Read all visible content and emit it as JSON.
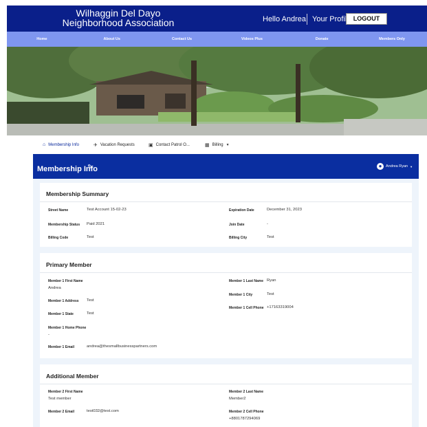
{
  "header": {
    "title_line1": "Wilhaggin Del Dayo",
    "title_line2": "Neighborhood Association",
    "greeting": "Hello Andrea",
    "profile_link": "Your Profile",
    "logout_label": "LOGOUT"
  },
  "nav": [
    "Home",
    "About Us",
    "Contact Us",
    "Videos Plus",
    "Donate",
    "Members Only"
  ],
  "tabs": {
    "membership": "Membership Info",
    "vacation": "Vacation Requests",
    "patrol": "Contact Patrol O...",
    "billing": "Billing"
  },
  "page": {
    "title": "Membership Info",
    "user_name": "Andrea Ryan"
  },
  "summary": {
    "heading": "Membership Summary",
    "street_name_label": "Street Name",
    "street_name": "Test Account 15-02-23",
    "status_label": "Membership Status",
    "status": "Paid 2021",
    "billing_code_label": "Billing Code",
    "billing_code": "Test",
    "expiration_label": "Expiration Date",
    "expiration": "December 31, 2023",
    "join_label": "Join Date",
    "join": "-",
    "billing_city_label": "Billing City",
    "billing_city": "Test"
  },
  "primary": {
    "heading": "Primary Member",
    "first_name_label": "Member 1 First Name",
    "first_name": "Andrea",
    "address_label": "Member 1 Address",
    "address": "Test",
    "state_label": "Member 1 State",
    "state": "Test",
    "home_phone_label": "Member 1 Home Phone",
    "home_phone": "-",
    "email_label": "Member 1 Email",
    "email": "andrea@thesmallbusinesspartners.com",
    "last_name_label": "Member 1 Last Name",
    "last_name": "Ryan",
    "city_label": "Member 1 City",
    "city": "Test",
    "cell_label": "Member 1 Cell Phone",
    "cell": "+17163319004"
  },
  "additional": {
    "heading": "Additional Member",
    "first_name_label": "Member 2 First Name",
    "first_name": "Test member",
    "email_label": "Member 2 Email",
    "email": "test032@test.com",
    "last_name_label": "Member 2 Last Name",
    "last_name": "Member2",
    "cell_label": "Member 2 Cell Phone",
    "cell": "+8801787294069"
  },
  "colors": {
    "header_bg": "#0a1f8a",
    "nav_bg": "#7f96f0",
    "section_header_bg": "#0a2ea0",
    "content_bg": "#eef4fb"
  }
}
